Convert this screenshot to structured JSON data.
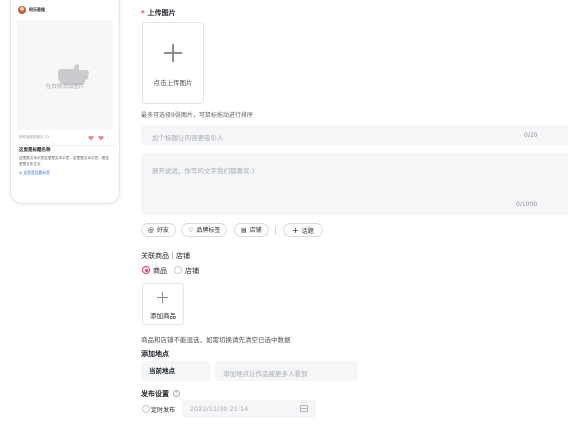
{
  "preview": {
    "account_name": "阿乐是程",
    "empty_hint": "在右侧添加图片",
    "meta_text": "该作品仅供参与 13",
    "title": "这里是标题名称",
    "description": "这里是文本示意这里是文本示意，这里是文本示意，是这里是文本正文",
    "topic_tag": "# 这里是话题标签"
  },
  "upload": {
    "section_label": "上传图片",
    "required_mark": "*",
    "button_label": "点击上传图片",
    "hint": "最多可选择9张图片，可鼠标拖动进行排序"
  },
  "title_input": {
    "placeholder": "加个标题让内容更吸引人",
    "counter": "0/20"
  },
  "body_input": {
    "placeholder": "展开说说，你写的文字我们都喜欢:)",
    "counter": "0/1000"
  },
  "toolbar": {
    "friend": "好友",
    "brand_tag": "品牌标签",
    "store": "店铺",
    "topic": "话题"
  },
  "related": {
    "label": "关联商品｜店铺",
    "option_goods": "商品",
    "option_store": "店铺",
    "selected": "商品",
    "add_goods": "添加商品",
    "note": "商品和店铺不能混选，如需切换请先清空已选中数据"
  },
  "location": {
    "label": "添加地点",
    "current_button": "当前地点",
    "placeholder": "添加地点让作品被更多人看到"
  },
  "publish": {
    "label": "发布设置",
    "help": "?",
    "scheduled_label": "定时发布",
    "datetime": "2022/11/30 21:14"
  },
  "colors": {
    "accent": "#ff2e4d",
    "field_bg": "#f5f6f7",
    "border": "#e3e5e8"
  }
}
